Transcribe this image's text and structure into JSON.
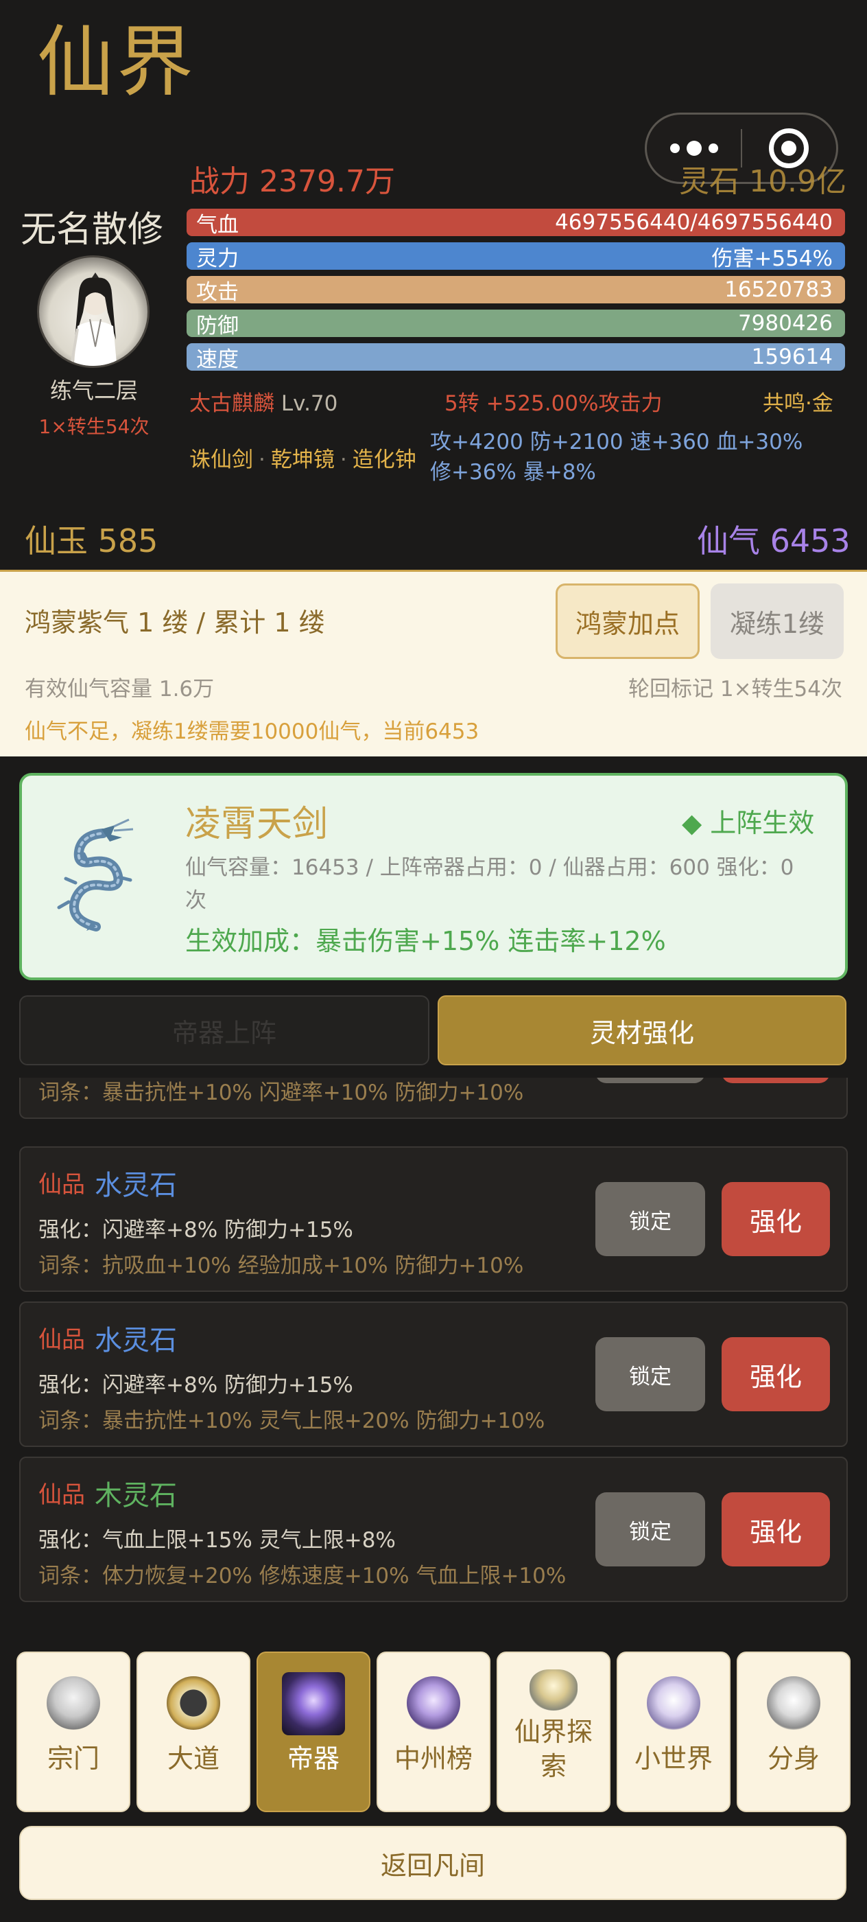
{
  "header": {
    "title": "仙界",
    "power": "战力 2379.7万",
    "lingshi": "灵石 10.9亿"
  },
  "player": {
    "name": "无名散修",
    "realm": "练气二层",
    "rebirth": "1×转生54次"
  },
  "stats": {
    "hp": {
      "label": "气血",
      "value": "4697556440/4697556440"
    },
    "mp": {
      "label": "灵力",
      "value": "伤害+554%"
    },
    "atk": {
      "label": "攻击",
      "value": "16520783"
    },
    "def": {
      "label": "防御",
      "value": "7980426"
    },
    "spd": {
      "label": "速度",
      "value": "159614"
    }
  },
  "pet": {
    "name": "太古麒麟",
    "level": "Lv.70",
    "buff": "5转 +525.00%攻击力",
    "resonance": "共鸣·金"
  },
  "artifacts": {
    "items": [
      "诛仙剑",
      "乾坤镜",
      "造化钟"
    ],
    "separator": "·",
    "bonus": "攻+4200 防+2100 速+360 血+30% 修+36% 暴+8%"
  },
  "currency": {
    "xianyu": "仙玉 585",
    "xianqi": "仙气 6453"
  },
  "hongmeng": {
    "title": "鸿蒙紫气 1 缕 / 累计 1 缕",
    "add_button": "鸿蒙加点",
    "refine_button": "凝练1缕",
    "capacity": "有效仙气容量 1.6万",
    "mark": "轮回标记 1×转生54次",
    "warning": "仙气不足，凝练1缕需要10000仙气，当前6453"
  },
  "equipped": {
    "name": "凌霄天剑",
    "status": "◆ 上阵生效",
    "info": "仙气容量：16453 / 上阵帝器占用：0 / 仙器占用：600  强化：0次",
    "bonus": "生效加成：暴击伤害+15%  连击率+12%"
  },
  "actions": {
    "deploy": "帝器上阵",
    "strengthen": "灵材强化"
  },
  "materials": [
    {
      "grade": "",
      "name": "",
      "enhance": "",
      "affix": "词条：暴击抗性+10% 闪避率+10% 防御力+10%",
      "lock": "",
      "boost": "",
      "color": "#5b8fe0"
    },
    {
      "grade": "仙品",
      "name": "水灵石",
      "enhance": "强化：闪避率+8% 防御力+15%",
      "affix": "词条：抗吸血+10% 经验加成+10% 防御力+10%",
      "lock": "锁定",
      "boost": "强化",
      "color": "#5b8fe0"
    },
    {
      "grade": "仙品",
      "name": "水灵石",
      "enhance": "强化：闪避率+8% 防御力+15%",
      "affix": "词条：暴击抗性+10% 灵气上限+20% 防御力+10%",
      "lock": "锁定",
      "boost": "强化",
      "color": "#5b8fe0"
    },
    {
      "grade": "仙品",
      "name": "木灵石",
      "enhance": "强化：气血上限+15% 灵气上限+8%",
      "affix": "词条：体力恢复+20% 修炼速度+10% 气血上限+10%",
      "lock": "锁定",
      "boost": "强化",
      "color": "#5fb360"
    }
  ],
  "nav": [
    {
      "label": "宗门",
      "icon": "temple-icon"
    },
    {
      "label": "大道",
      "icon": "taiji-icon"
    },
    {
      "label": "帝器",
      "icon": "emperor-artifact-icon",
      "active": true
    },
    {
      "label": "中州榜",
      "icon": "ranking-icon"
    },
    {
      "label": "仙界探索",
      "icon": "explore-icon"
    },
    {
      "label": "小世界",
      "icon": "small-world-icon"
    },
    {
      "label": "分身",
      "icon": "avatar-clone-icon"
    }
  ],
  "footer": {
    "return_button": "返回凡间"
  }
}
